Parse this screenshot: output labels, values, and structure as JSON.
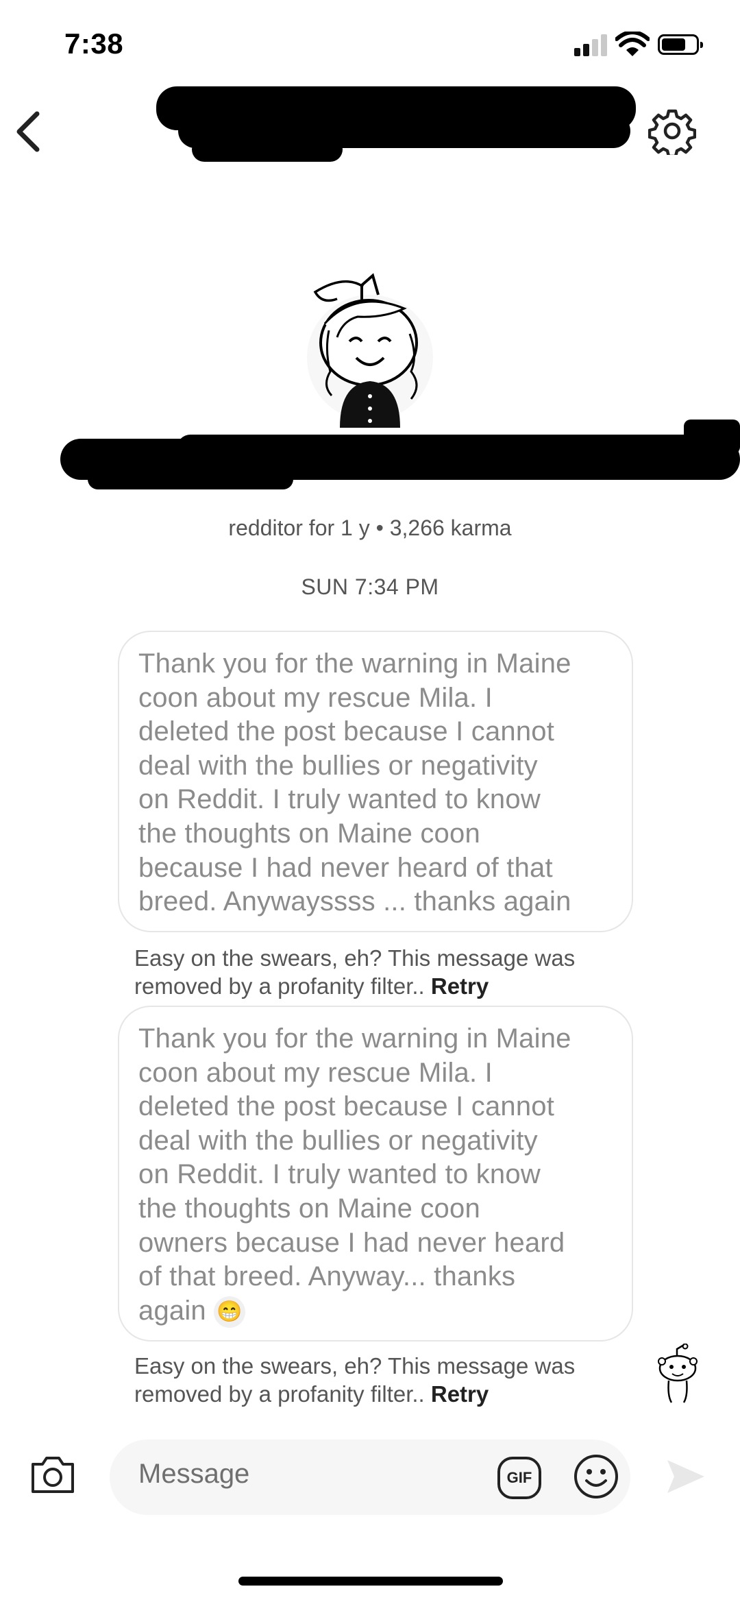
{
  "status_bar": {
    "time": "7:38"
  },
  "header": {
    "back_icon": "chevron-left-icon",
    "settings_icon": "gear-icon"
  },
  "profile": {
    "meta": "redditor for 1 y • 3,266 karma"
  },
  "thread": {
    "day_label": "SUN 7:34 PM",
    "messages": [
      {
        "text": "Thank you for the warning in Maine\ncoon about my rescue Mila. I\ndeleted the post because I cannot\ndeal with the bullies or negativity\non Reddit. I truly wanted to know\nthe thoughts on Maine coon\nbecause I had never heard of that\nbreed. Anywayssss ... thanks again",
        "error": "Easy on the swears, eh? This message was removed by a profanity filter..",
        "retry": "Retry"
      },
      {
        "text": "Thank you for the warning in Maine\ncoon about my rescue Mila. I\ndeleted the post because I cannot\ndeal with the bullies or negativity\non Reddit. I truly wanted to know\nthe thoughts on Maine coon\nowners because I had never heard\nof that breed. Anyway... thanks\nagain",
        "emoji": "😁",
        "error": "Easy on the swears, eh? This message was removed by a profanity filter..",
        "retry": "Retry"
      }
    ]
  },
  "composer": {
    "placeholder": "Message",
    "gif_label": "GIF",
    "camera_icon": "camera-icon",
    "emoji_icon": "smiley-icon",
    "send_icon": "send-icon"
  },
  "colors": {
    "bubble_border": "#e6e6e6",
    "message_text": "#8b8b8b"
  }
}
